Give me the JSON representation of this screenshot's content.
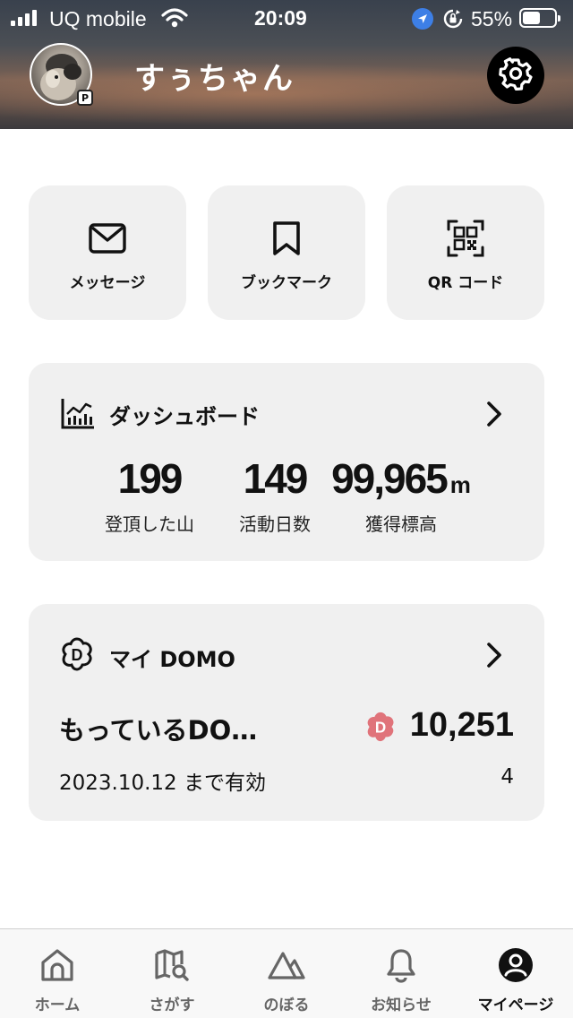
{
  "status_bar": {
    "carrier": "UQ mobile",
    "time": "20:09",
    "battery_percent": "55%",
    "battery_level": 0.55
  },
  "profile": {
    "username": "すぅちゃん",
    "badge": "P"
  },
  "quick_actions": [
    {
      "label": "メッセージ",
      "icon": "mail-icon"
    },
    {
      "label": "ブックマーク",
      "icon": "bookmark-icon"
    },
    {
      "label": "QR コード",
      "icon": "qr-code-icon"
    }
  ],
  "dashboard": {
    "title": "ダッシュボード",
    "stats": [
      {
        "value": "199",
        "unit": "",
        "label": "登頂した山"
      },
      {
        "value": "149",
        "unit": "",
        "label": "活動日数"
      },
      {
        "value": "99,965",
        "unit": "m",
        "label": "獲得標高"
      }
    ]
  },
  "domo": {
    "title": "マイ DOMO",
    "held_label": "もっているDO…",
    "points": "10,251",
    "expiry": "2023.10.12 まで有効",
    "count": "4",
    "coin_letter": "D",
    "coin_color": "#e0737a"
  },
  "tabs": [
    {
      "label": "ホーム",
      "icon": "home-icon"
    },
    {
      "label": "さがす",
      "icon": "map-search-icon"
    },
    {
      "label": "のぼる",
      "icon": "mountain-icon"
    },
    {
      "label": "お知らせ",
      "icon": "bell-icon"
    },
    {
      "label": "マイページ",
      "icon": "user-icon",
      "active": true
    }
  ]
}
